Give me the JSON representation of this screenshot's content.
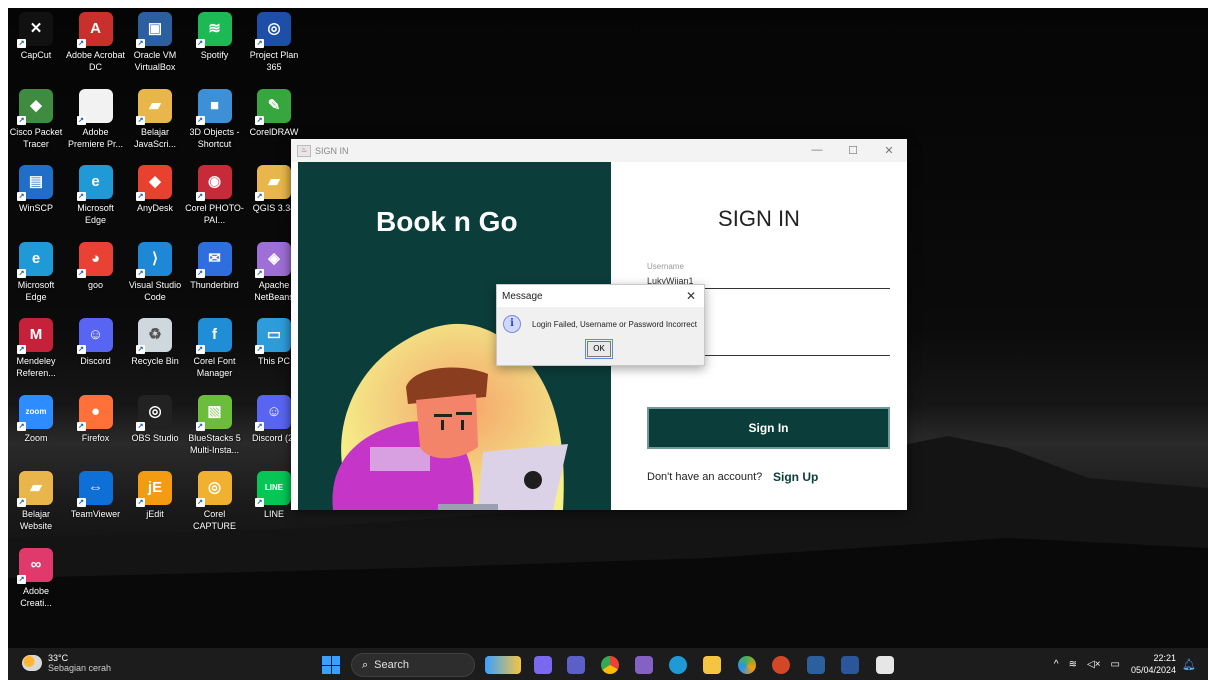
{
  "desktop_icons": [
    {
      "label": "CapCut",
      "color": "#111111",
      "glyph": "✕"
    },
    {
      "label": "Adobe Acrobat DC",
      "color": "#c9302c",
      "glyph": "A"
    },
    {
      "label": "Oracle VM VirtualBox",
      "color": "#2b5f9e",
      "glyph": "▣"
    },
    {
      "label": "Spotify",
      "color": "#1db954",
      "glyph": "≋"
    },
    {
      "label": "Project Plan 365",
      "color": "#1e4fa8",
      "glyph": "◎"
    },
    {
      "label": "Cisco Packet Tracer",
      "color": "#3f8b3f",
      "glyph": "◆"
    },
    {
      "label": "Adobe Premiere Pr...",
      "color": "#f2f2f2",
      "glyph": ""
    },
    {
      "label": "Belajar JavaScri...",
      "color": "#e8b64a",
      "glyph": "▰"
    },
    {
      "label": "3D Objects - Shortcut",
      "color": "#3d8fd6",
      "glyph": "■"
    },
    {
      "label": "CorelDRAW",
      "color": "#37a63e",
      "glyph": "✎"
    },
    {
      "label": "WinSCP",
      "color": "#1f6ec7",
      "glyph": "▤"
    },
    {
      "label": "Microsoft Edge",
      "color": "#1f9ad6",
      "glyph": "e"
    },
    {
      "label": "AnyDesk",
      "color": "#e8412f",
      "glyph": "◆"
    },
    {
      "label": "Corel PHOTO-PAI...",
      "color": "#c72b3a",
      "glyph": "◉"
    },
    {
      "label": "QGIS 3.34",
      "color": "#e8b64a",
      "glyph": "▰"
    },
    {
      "label": "Microsoft Edge",
      "color": "#1f9ad6",
      "glyph": "e"
    },
    {
      "label": "goo",
      "color": "#e94235",
      "glyph": "◕"
    },
    {
      "label": "Visual Studio Code",
      "color": "#1e88d6",
      "glyph": "⟩"
    },
    {
      "label": "Thunderbird",
      "color": "#2f6fdd",
      "glyph": "✉"
    },
    {
      "label": "Apache NetBeans",
      "color": "#9e6fd6",
      "glyph": "◈"
    },
    {
      "label": "Mendeley Referen...",
      "color": "#c5213a",
      "glyph": "M"
    },
    {
      "label": "Discord",
      "color": "#5865f2",
      "glyph": "☺"
    },
    {
      "label": "Recycle Bin",
      "color": "#cfd8dc",
      "glyph": "♻"
    },
    {
      "label": "Corel Font Manager",
      "color": "#1f8ed6",
      "glyph": "f"
    },
    {
      "label": "This PC",
      "color": "#2d9cdb",
      "glyph": "▭"
    },
    {
      "label": "Zoom",
      "color": "#2d8cff",
      "glyph": "zoom"
    },
    {
      "label": "Firefox",
      "color": "#ff7139",
      "glyph": "●"
    },
    {
      "label": "OBS Studio",
      "color": "#222222",
      "glyph": "◎"
    },
    {
      "label": "BlueStacks 5 Multi-Insta...",
      "color": "#6bbd3b",
      "glyph": "▧"
    },
    {
      "label": "Discord (2)",
      "color": "#5865f2",
      "glyph": "☺"
    },
    {
      "label": "Belajar Website",
      "color": "#e8b64a",
      "glyph": "▰"
    },
    {
      "label": "TeamViewer",
      "color": "#0e6fd6",
      "glyph": "⇔"
    },
    {
      "label": "jEdit",
      "color": "#f39c12",
      "glyph": "jE"
    },
    {
      "label": "Corel CAPTURE",
      "color": "#f0b030",
      "glyph": "◎"
    },
    {
      "label": "LINE",
      "color": "#06c755",
      "glyph": "LINE"
    },
    {
      "label": "Adobe Creati...",
      "color": "#e03a6c",
      "glyph": "∞"
    }
  ],
  "window": {
    "title": "SIGN IN",
    "minimize": "—",
    "maximize": "☐",
    "close": "✕",
    "brand": "Book n Go",
    "heading": "SIGN IN",
    "username_label": "Username",
    "username_value": "LukyWijan1",
    "signin_button": "Sign In",
    "no_account_text": "Don't have an account?",
    "signup_link": "Sign Up",
    "accent_color": "#0b3d3a"
  },
  "dialog": {
    "title": "Message",
    "close": "✕",
    "icon": "info-icon",
    "message": "Login Failed, Username or Password Incorrect",
    "ok_button": "OK"
  },
  "taskbar": {
    "temperature": "33°C",
    "weather": "Sebagian cerah",
    "search_placeholder": "Search",
    "time": "22:21",
    "date": "05/04/2024"
  }
}
